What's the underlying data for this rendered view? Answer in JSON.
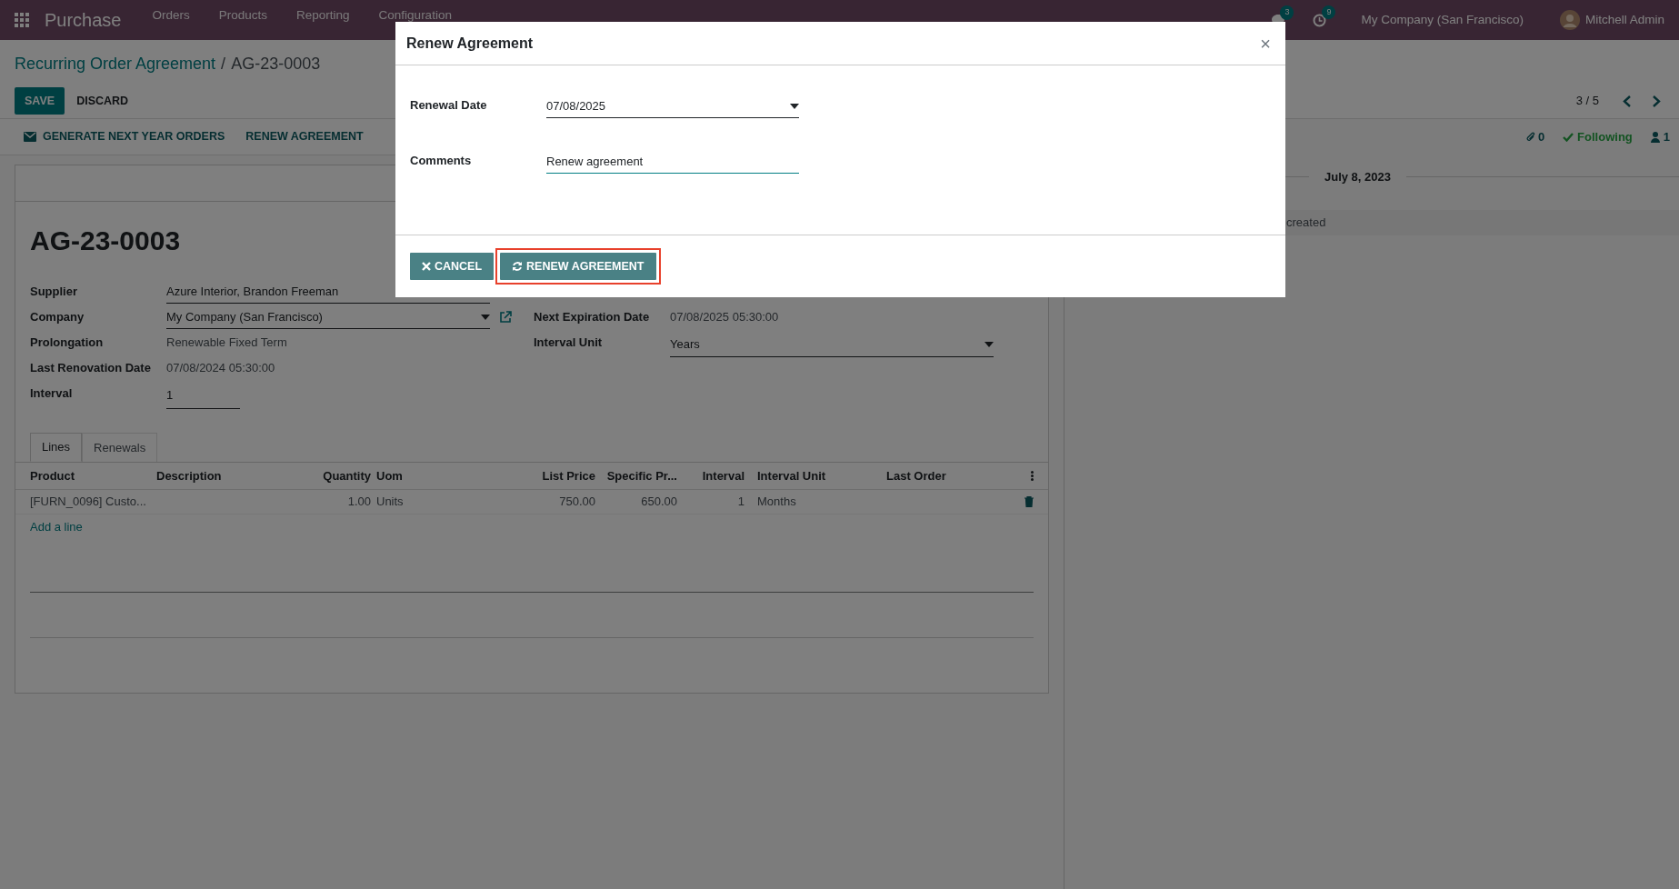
{
  "navbar": {
    "app_name": "Purchase",
    "menu": [
      "Orders",
      "Products",
      "Reporting",
      "Configuration"
    ],
    "messages_count": "3",
    "activities_count": "9",
    "company": "My Company (San Francisco)",
    "user": "Mitchell Admin"
  },
  "breadcrumb": {
    "parent": "Recurring Order Agreement",
    "separator": "/",
    "current": "AG-23-0003"
  },
  "buttons": [
    {
      "label": "SAVE",
      "kind": "primary"
    },
    {
      "label": "DISCARD",
      "kind": "secondary"
    }
  ],
  "pager": "3 / 5",
  "actions": [
    {
      "label": "GENERATE NEXT YEAR ORDERS",
      "kind": "mail"
    },
    {
      "label": "RENEW AGREEMENT",
      "kind": "plain"
    }
  ],
  "chatter": {
    "attachments": "0",
    "following": "Following",
    "followers": "1",
    "date": "July 8, 2023",
    "message": "created"
  },
  "form": {
    "title": "AG-23-0003",
    "left_fields": [
      {
        "label": "Supplier",
        "value": "Azure Interior, Brandon Freeman",
        "kind": "input"
      },
      {
        "label": "Company",
        "value": "My Company (San Francisco)",
        "kind": "link"
      },
      {
        "label": "Prolongation",
        "value": "Renewable Fixed Term",
        "kind": "readonly"
      },
      {
        "label": "Last Renovation Date",
        "value": "07/08/2024 05:30:00",
        "kind": "readonly"
      },
      {
        "label": "Interval",
        "value": "1",
        "kind": "short"
      }
    ],
    "right_fields": [
      {
        "label": "Next Expiration Date",
        "value": "07/08/2025 05:30:00",
        "kind": "readonly"
      },
      {
        "label": "Interval Unit",
        "value": "Years",
        "kind": "select"
      }
    ]
  },
  "tabs": [
    {
      "label": "Lines",
      "selected": true
    },
    {
      "label": "Renewals",
      "selected": false
    }
  ],
  "lines": {
    "columns": [
      "Product",
      "Description",
      "Quantity",
      "Uom",
      "List Price",
      "Specific Pr...",
      "Interval",
      "Interval Unit",
      "Last Order"
    ],
    "rows": [
      [
        "[FURN_0096] Custo...",
        "",
        "1.00",
        "Units",
        "750.00",
        "650.00",
        "1",
        "Months",
        ""
      ]
    ],
    "add_line": "Add a line"
  },
  "dialog": {
    "title": "Renew Agreement",
    "close": "×",
    "fields": [
      {
        "label": "Renewal Date",
        "value": "07/08/2025",
        "kind": "select"
      },
      {
        "label": "Comments",
        "value": "Renew agreement",
        "kind": "focused"
      }
    ],
    "buttons": [
      {
        "label": "CANCEL",
        "kind": "cancel",
        "highlighted": false
      },
      {
        "label": "RENEW AGREEMENT",
        "kind": "confirm",
        "highlighted": true
      }
    ]
  }
}
